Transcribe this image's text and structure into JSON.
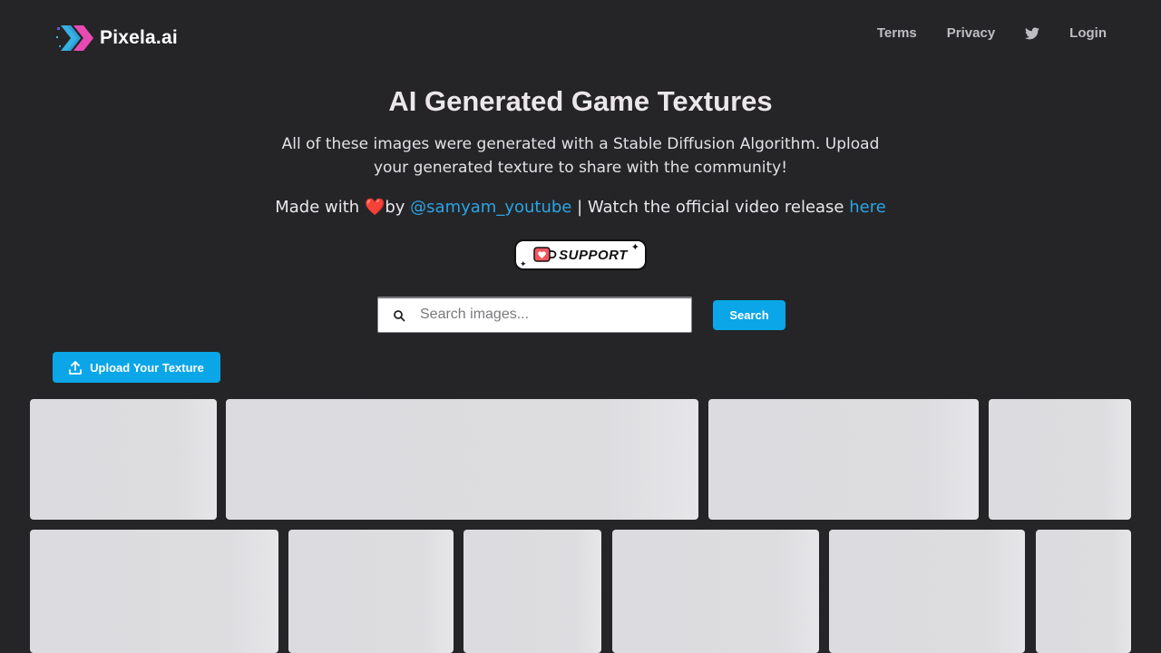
{
  "header": {
    "logo_text": "Pixela.ai",
    "nav": {
      "terms": "Terms",
      "privacy": "Privacy",
      "twitter_icon": "twitter-icon",
      "login": "Login"
    }
  },
  "hero": {
    "title": "AI Generated Game Textures",
    "description": "All of these images were generated with a Stable Diffusion Algorithm. Upload your generated texture to share with the community!",
    "made_with_prefix": "Made with",
    "heart": "❤️",
    "by": "by",
    "author_handle": "@samyam_youtube",
    "separator_text": " | Watch the official video release ",
    "video_link": "here"
  },
  "support": {
    "label": "SUPPORT",
    "icon": "coffee-cup-heart-icon"
  },
  "search": {
    "placeholder": "Search images...",
    "value": "",
    "button_label": "Search"
  },
  "upload": {
    "label": "Upload Your Texture",
    "icon": "upload-icon"
  },
  "colors": {
    "background": "#252527",
    "accent": "#0aa6e8",
    "link": "#2aa4e6",
    "tile_placeholder": "#dcdbdf"
  }
}
